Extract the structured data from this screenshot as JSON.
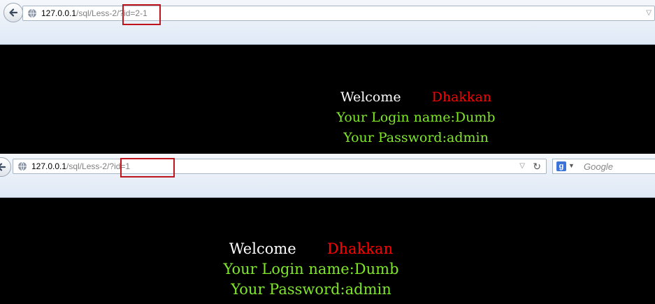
{
  "screenshot1": {
    "url": {
      "host": "127.0.0.1",
      "path": "/sql/Less-2/?id=2-1"
    },
    "welcome": "Welcome",
    "username_display": "Dhakkan",
    "login_name": "Your Login name:Dumb",
    "password": "Your Password:admin"
  },
  "screenshot2": {
    "url": {
      "host": "127.0.0.1",
      "path": "/sql/Less-2/?id=1"
    },
    "search_placeholder": "Google",
    "welcome": "Welcome",
    "username_display": "Dhakkan",
    "login_name": "Your Login name:Dumb",
    "password": "Your Password:admin"
  },
  "colors": {
    "page_background": "#000000",
    "welcome_text": "#ffffff",
    "name_text": "#ff0000",
    "info_text": "#7fe62a",
    "highlight_border": "#c0141c"
  },
  "icons": [
    "back-arrow-icon",
    "globe-icon",
    "dropdown-arrow-icon",
    "reload-icon",
    "google-icon"
  ]
}
